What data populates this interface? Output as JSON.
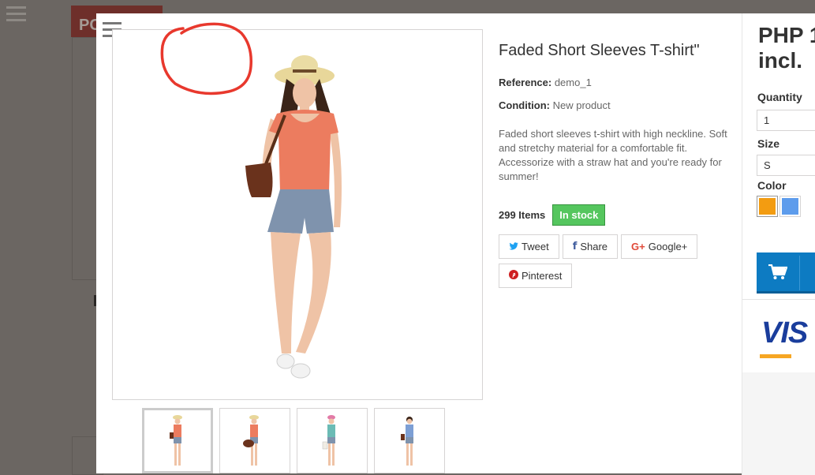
{
  "background": {
    "banner_text": "PC"
  },
  "product": {
    "name": "Faded Short Sleeves T-shirt\"",
    "reference_label": "Reference:",
    "reference_value": "demo_1",
    "condition_label": "Condition:",
    "condition_value": "New product",
    "description": "Faded short sleeves t-shirt with high neckline. Soft and stretchy material for a comfortable fit. Accessorize with a straw hat and you're ready for summer!",
    "quantity_count": "299 Items",
    "stock_status": "In stock"
  },
  "social": {
    "tweet": "Tweet",
    "share": "Share",
    "google": "Google+",
    "pinterest": "Pinterest"
  },
  "purchase": {
    "price_line1": "PHP 1",
    "price_line2": "incl.",
    "quantity_label": "Quantity",
    "quantity_value": "1",
    "size_label": "Size",
    "size_value": "S",
    "color_label": "Color",
    "colors": [
      "#f39c11",
      "#5d9cec"
    ]
  },
  "payment": {
    "visa_text": "VIS"
  },
  "colors": {
    "overlay": "#6b6662",
    "in_stock": "#55c65e",
    "cart_button": "#0d7bc2",
    "annotation": "#e8382d"
  },
  "thumbnails_count": 4
}
